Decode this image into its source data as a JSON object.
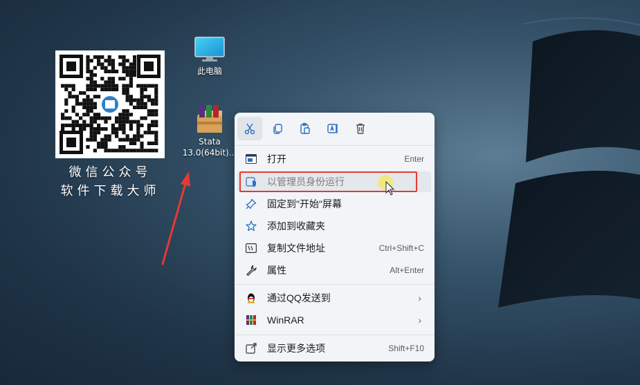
{
  "qr": {
    "caption_line1": "微信公众号",
    "caption_line2": "软件下载大师"
  },
  "desktop_icons": {
    "pc_label": "此电脑",
    "stata_label_line1": "Stata",
    "stata_label_line2": "13.0(64bit)..."
  },
  "context_menu": {
    "toolbar": [
      "cut-icon",
      "copy-icon",
      "paste-icon",
      "rename-icon",
      "delete-icon"
    ],
    "items": [
      {
        "label": "打开",
        "shortcut": "Enter"
      },
      {
        "label": "以管理员身份运行",
        "shortcut": ""
      },
      {
        "label": "固定到\"开始\"屏幕",
        "shortcut": ""
      },
      {
        "label": "添加到收藏夹",
        "shortcut": ""
      },
      {
        "label": "复制文件地址",
        "shortcut": "Ctrl+Shift+C"
      },
      {
        "label": "属性",
        "shortcut": "Alt+Enter"
      },
      {
        "label": "通过QQ发送到",
        "shortcut": ""
      },
      {
        "label": "WinRAR",
        "shortcut": ""
      },
      {
        "label": "显示更多选项",
        "shortcut": "Shift+F10"
      }
    ]
  },
  "colors": {
    "accent": "#2b6fc2",
    "highlight_border": "#e53935",
    "menu_bg": "#f2f4f7"
  }
}
